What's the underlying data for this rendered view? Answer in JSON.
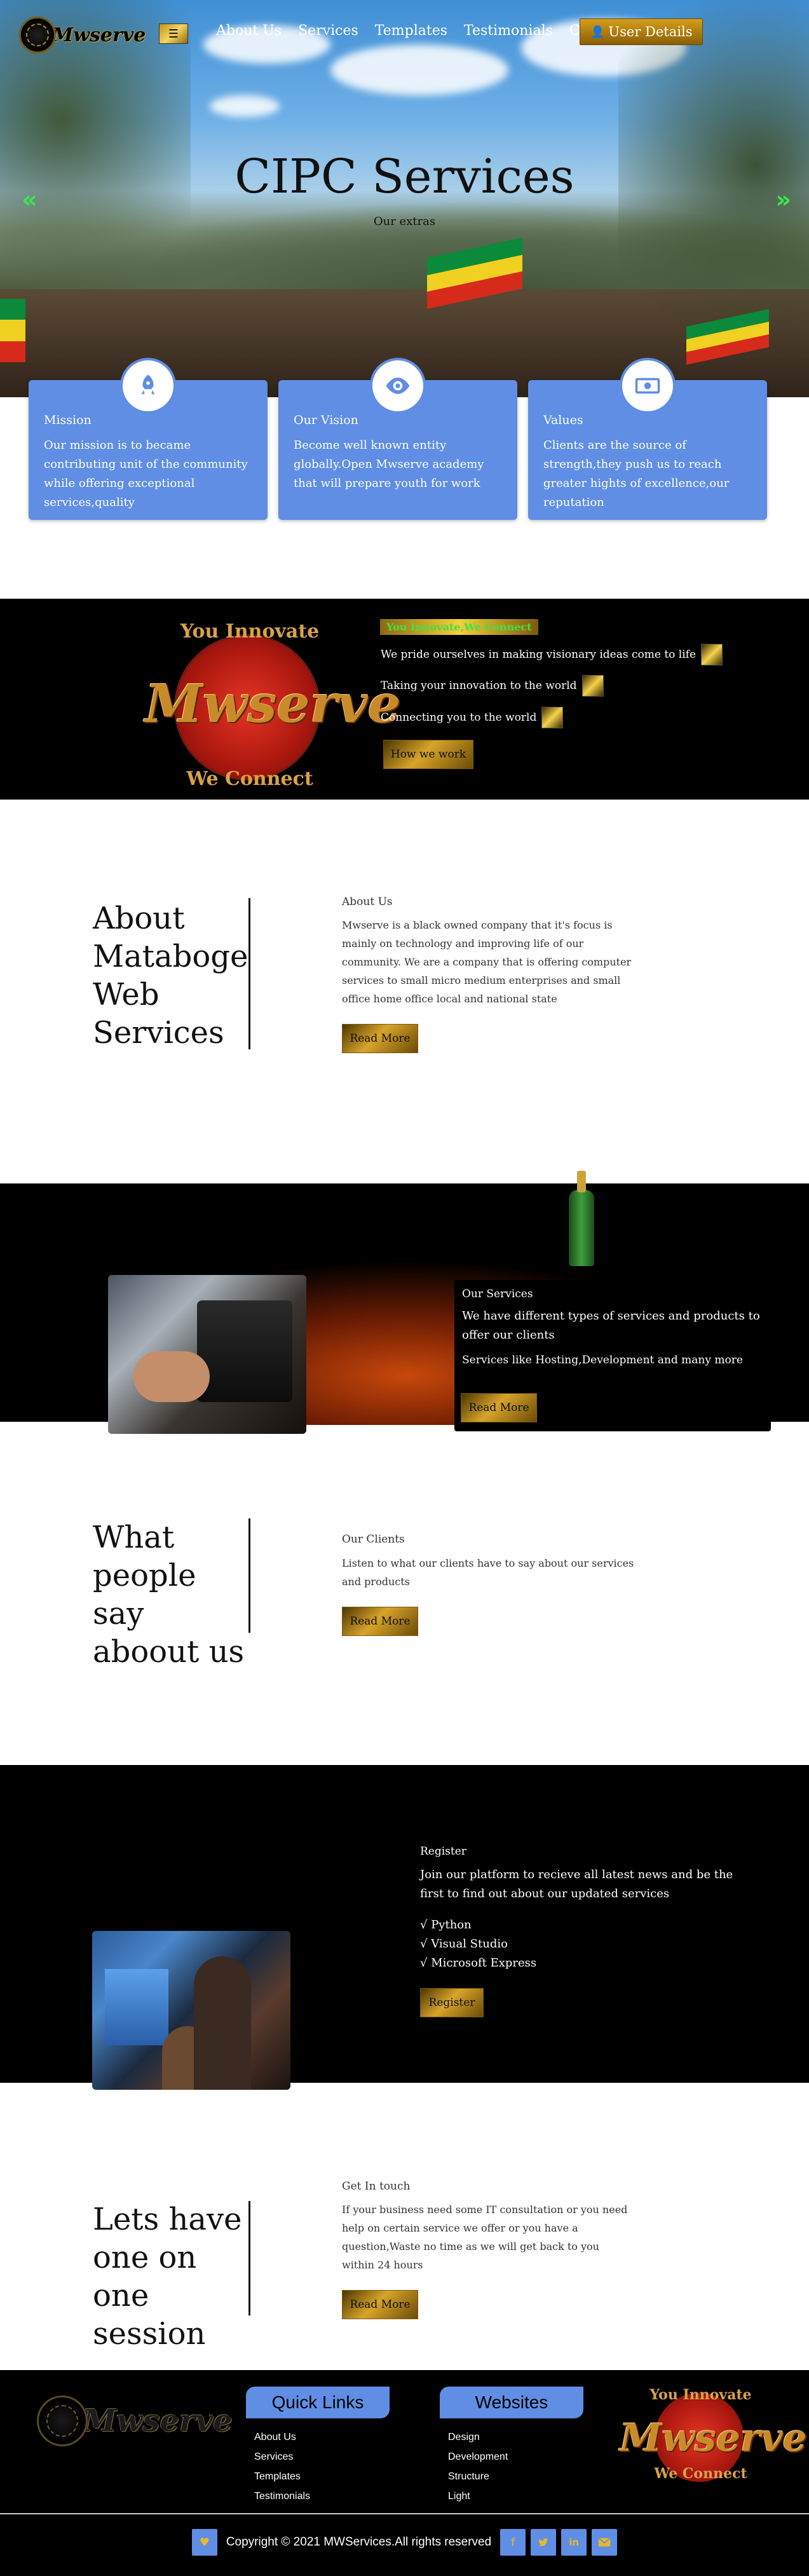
{
  "brand": {
    "logo_text": "Mwserve"
  },
  "nav": {
    "menu_icon": "hamburger-icon",
    "links": [
      "About Us",
      "Services",
      "Templates",
      "Testimonials",
      "Contacts"
    ],
    "user_button": "User Details",
    "user_icon": "user-icon"
  },
  "hero": {
    "title": "CIPC Services",
    "subtitle": "Our extras",
    "prev_arrow": "«",
    "next_arrow": "»"
  },
  "cards": [
    {
      "icon": "rocket-icon",
      "title": "Mission",
      "text": "Our mission is to became contributing unit of the community while offering exceptional services,quality"
    },
    {
      "icon": "eye-icon",
      "title": "Our Vision",
      "text": "Become well known entity globally.Open Mwserve academy that will prepare youth for work"
    },
    {
      "icon": "money-icon",
      "title": "Values",
      "text": "Clients are the source of strength,they push us to reach greater hights of excellence,our reputation"
    }
  ],
  "innovate": {
    "logo_top": "You Innovate",
    "logo_brand": "Mwserve",
    "logo_bottom": "We Connect",
    "badge": "You Innovate,We Connect",
    "lines": [
      "We pride ourselves in making visionary ideas come to life",
      "Taking your innovation to the world",
      "Connecting you to the world"
    ],
    "button": "How we work"
  },
  "about": {
    "heading": "About Mataboge Web Services",
    "label": "About Us",
    "text": "Mwserve is a black owned company that it's focus is mainly on technology and improving life of our community. We are a company that is offering computer services to small micro medium enterprises and small office home office local and national state",
    "button": "Read More"
  },
  "services": {
    "title": "Our Services",
    "text": "We have different types of services and products to offer our clients",
    "text2": "Services like Hosting,Development and many more",
    "button": "Read More"
  },
  "clients": {
    "heading": "What people say aboout us",
    "label": "Our Clients",
    "text": "Listen to what our clients have to say about our services and products",
    "button": "Read More"
  },
  "register": {
    "title": "Register",
    "text": "Join our platform to recieve all latest news and be the first to find out about our updated services",
    "items": [
      "√ Python",
      "√ Visual Studio",
      "√ Microsoft Express"
    ],
    "button": "Register"
  },
  "contact": {
    "heading": "Lets have one on one session",
    "label": "Get In touch",
    "text": "If your business need some IT consultation or you need help on certain service we offer or you have a question,Waste no time as we will get back to you within 24 hours",
    "button": "Read More"
  },
  "footer": {
    "logo_text": "Mwserve",
    "quick_links_title": "Quick Links",
    "quick_links": [
      "About Us",
      "Services",
      "Templates",
      "Testimonials"
    ],
    "websites_title": "Websites",
    "websites": [
      "Design",
      "Development",
      "Structure",
      "Light"
    ],
    "logo_top": "You Innovate",
    "logo_brand": "Mwserve",
    "logo_bottom": "We Connect",
    "copyright": "Copyright © 2021 MWServices.All rights reserved",
    "heart_icon": "heart-icon",
    "social": [
      "facebook-icon",
      "twitter-icon",
      "linkedin-icon",
      "mail-icon"
    ]
  },
  "colors": {
    "accent_blue": "#5f8ee4",
    "gold": "#d8a42a",
    "arrow_green": "#38e84f"
  }
}
